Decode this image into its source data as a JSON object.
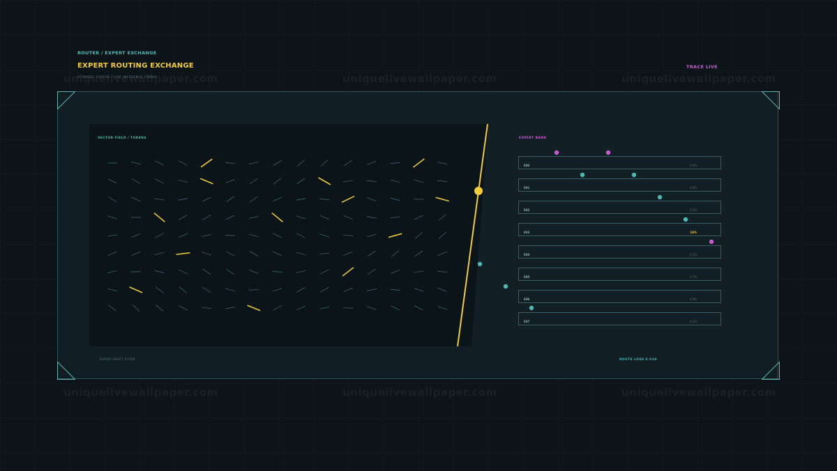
{
  "header": {
    "breadcrumb": "ROUTER / EXPERT EXCHANGE",
    "title": "EXPERT ROUTING EXCHANGE",
    "subtitle": "AI MODEL STATUS / LIVE INFERENCE FABRIC",
    "status": "TRACE LIVE"
  },
  "watermark": "uniquelivewallpaper.com",
  "vector_panel": {
    "label": "VECTOR FIELD / TOKENS",
    "footer": "SHARP SHIFT 07/08"
  },
  "expert_bank": {
    "label": "EXPERT BANK",
    "experts": [
      {
        "id": "E00",
        "value": "0.6%",
        "active": false
      },
      {
        "id": "E01",
        "value": "0.8%",
        "active": false
      },
      {
        "id": "E02",
        "value": "1.1%",
        "active": false
      },
      {
        "id": "E03",
        "value": "18%",
        "active": true
      },
      {
        "id": "E04",
        "value": "1.1%",
        "active": false
      },
      {
        "id": "E05",
        "value": "3.7%",
        "active": false
      },
      {
        "id": "E06",
        "value": "0.9%",
        "active": false
      },
      {
        "id": "E07",
        "value": "4.1%",
        "active": false
      }
    ],
    "footer": "ROUTE LOSS 0.018"
  },
  "colors": {
    "accent_yellow": "#f2cc3a",
    "accent_teal": "#4fb8b5",
    "accent_magenta": "#c65dd0",
    "frame": "#2e5560",
    "background": "#0c1418"
  }
}
